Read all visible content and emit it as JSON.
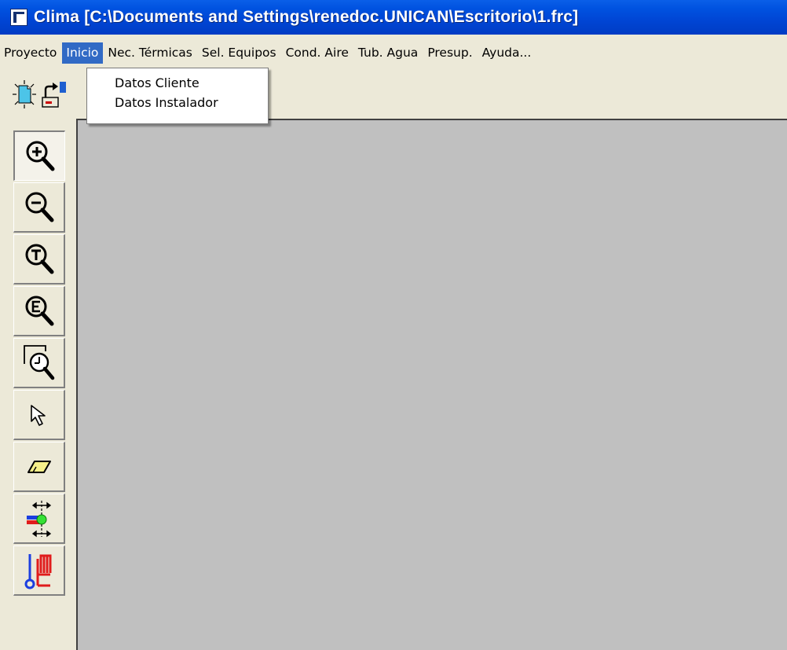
{
  "window": {
    "title": "Clima [C:\\Documents and Settings\\renedoc.UNICAN\\Escritorio\\1.frc]",
    "title_bar_color": "#0054e3"
  },
  "menubar": {
    "items": [
      {
        "label": "Proyecto",
        "active": false
      },
      {
        "label": "Inicio",
        "active": true
      },
      {
        "label": "Nec. Térmicas",
        "active": false
      },
      {
        "label": "Sel. Equipos",
        "active": false
      },
      {
        "label": "Cond. Aire",
        "active": false
      },
      {
        "label": "Tub. Agua",
        "active": false
      },
      {
        "label": "Presup.",
        "active": false
      },
      {
        "label": "Ayuda...",
        "active": false
      }
    ],
    "highlight_color": "#316ac5"
  },
  "dropdown": {
    "parent": "Inicio",
    "items": [
      {
        "label": "Datos Cliente"
      },
      {
        "label": "Datos Instalador"
      }
    ]
  },
  "toolbar_top": {
    "buttons": [
      "new-document-icon",
      "export-icon"
    ]
  },
  "side_toolbar": {
    "tools": [
      {
        "icon": "zoom-in-icon",
        "pressed": true
      },
      {
        "icon": "zoom-out-icon",
        "pressed": false
      },
      {
        "icon": "zoom-total-icon",
        "pressed": false
      },
      {
        "icon": "zoom-extents-icon",
        "pressed": false
      },
      {
        "icon": "zoom-window-icon",
        "pressed": false
      },
      {
        "icon": "pointer-icon",
        "pressed": false
      },
      {
        "icon": "eraser-icon",
        "pressed": false
      },
      {
        "icon": "pipe-connection-icon",
        "pressed": false
      },
      {
        "icon": "radiator-icon",
        "pressed": false
      }
    ]
  },
  "canvas": {
    "background": "#c0c0c0"
  }
}
